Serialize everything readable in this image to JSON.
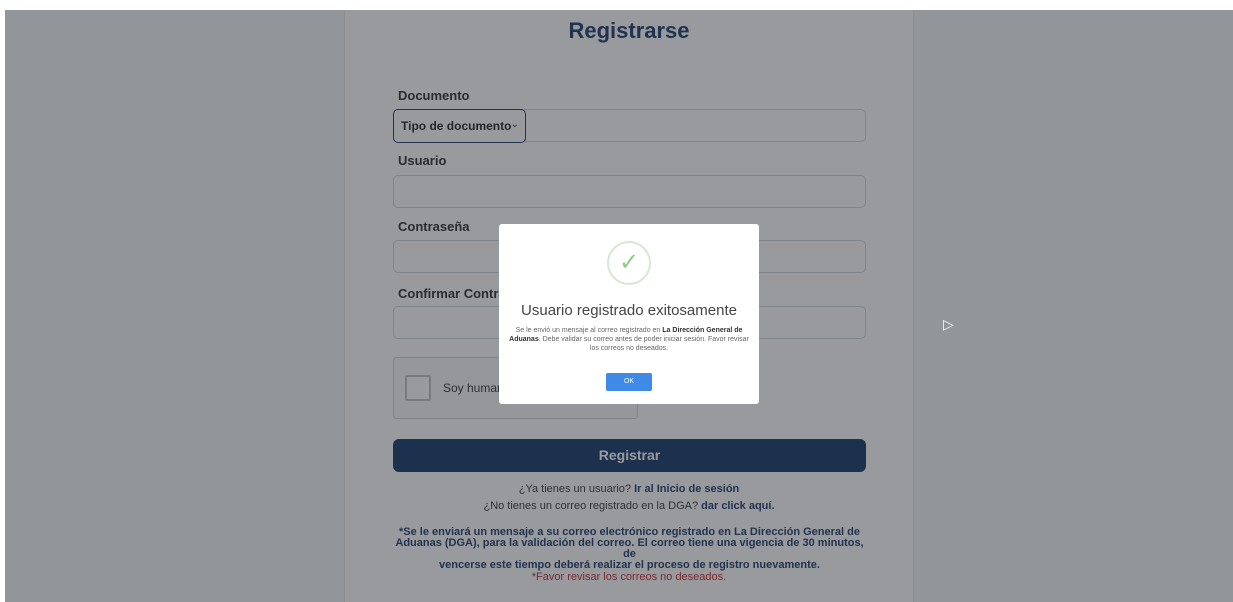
{
  "form": {
    "title": "Registrarse",
    "documento_label": "Documento",
    "tipo_documento": "Tipo de documento",
    "usuario_label": "Usuario",
    "contrasena_label": "Contraseña",
    "confirmar_label": "Confirmar Contraseña",
    "captcha_label": "Soy humano",
    "submit_label": "Registrar"
  },
  "links": {
    "login_prefix": "¿Ya tienes un usuario?",
    "login_link": "Ir al Inicio de sesión",
    "email_prefix": "¿No tienes un correo registrado en la DGA?",
    "email_link": "dar click aquí."
  },
  "notes": {
    "line1": "*Se le enviará un mensaje a su correo electrónico registrado en La Dirección General de",
    "line2": "Aduanas (DGA), para la validación del correo. El correo tiene una vigencia de 30 minutos, de",
    "line3": "vencerse este tiempo deberá realizar el proceso de registro nuevamente.",
    "warning": "*Favor revisar los correos no deseados."
  },
  "modal": {
    "title": "Usuario registrado exitosamente",
    "text_prefix": "Se le envió un mensaje al correo registrado en",
    "text_bold": "La Dirección General de Aduanas",
    "text_suffix": ". Debe validar su correo antes de poder iniciar sesión. Favor revisar los correos no deseados.",
    "ok_label": "OK"
  },
  "colors": {
    "primary": "#133766",
    "success": "#8ccf7e",
    "ok_button": "#3e8ae6",
    "warning": "#c62828"
  }
}
